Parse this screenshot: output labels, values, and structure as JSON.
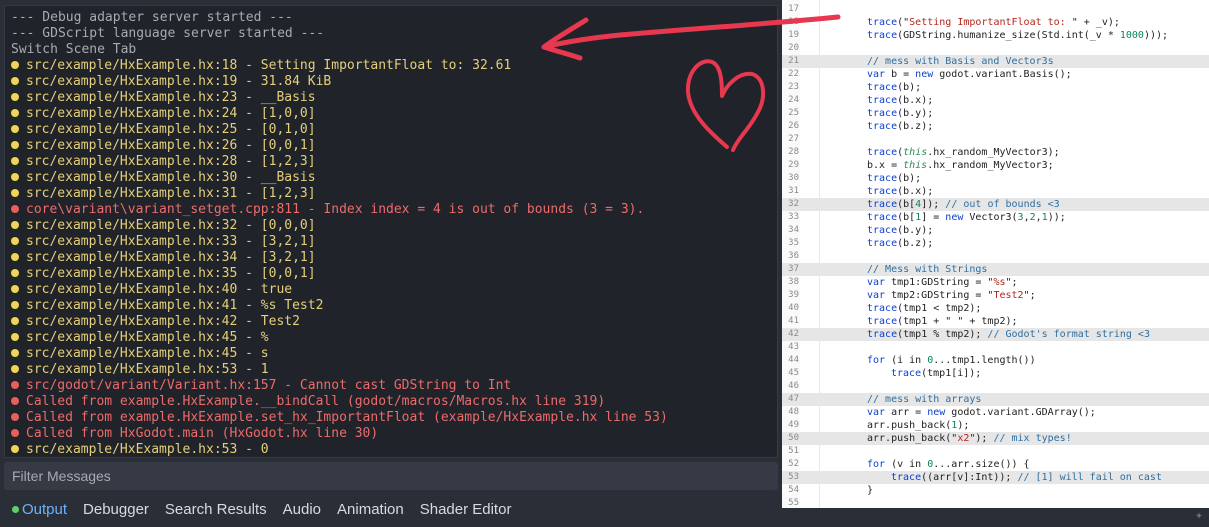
{
  "output": {
    "lines": [
      {
        "type": "plain",
        "text": "--- Debug adapter server started ---"
      },
      {
        "type": "plain",
        "text": "--- GDScript language server started ---"
      },
      {
        "type": "plain",
        "text": "Switch Scene Tab"
      },
      {
        "type": "warn",
        "text": "src/example/HxExample.hx:18 - Setting ImportantFloat to: 32.61"
      },
      {
        "type": "warn",
        "text": "src/example/HxExample.hx:19 - 31.84 KiB"
      },
      {
        "type": "warn",
        "text": "src/example/HxExample.hx:23 - __Basis"
      },
      {
        "type": "warn",
        "text": "src/example/HxExample.hx:24 - [1,0,0]"
      },
      {
        "type": "warn",
        "text": "src/example/HxExample.hx:25 - [0,1,0]"
      },
      {
        "type": "warn",
        "text": "src/example/HxExample.hx:26 - [0,0,1]"
      },
      {
        "type": "warn",
        "text": "src/example/HxExample.hx:28 - [1,2,3]"
      },
      {
        "type": "warn",
        "text": "src/example/HxExample.hx:30 - __Basis"
      },
      {
        "type": "warn",
        "text": "src/example/HxExample.hx:31 - [1,2,3]"
      },
      {
        "type": "error",
        "text": "core\\variant\\variant_setget.cpp:811 - Index index = 4 is out of bounds (3 = 3)."
      },
      {
        "type": "warn",
        "text": "src/example/HxExample.hx:32 - [0,0,0]"
      },
      {
        "type": "warn",
        "text": "src/example/HxExample.hx:33 - [3,2,1]"
      },
      {
        "type": "warn",
        "text": "src/example/HxExample.hx:34 - [3,2,1]"
      },
      {
        "type": "warn",
        "text": "src/example/HxExample.hx:35 - [0,0,1]"
      },
      {
        "type": "warn",
        "text": "src/example/HxExample.hx:40 - true"
      },
      {
        "type": "warn",
        "text": "src/example/HxExample.hx:41 - %s Test2"
      },
      {
        "type": "warn",
        "text": "src/example/HxExample.hx:42 - Test2"
      },
      {
        "type": "warn",
        "text": "src/example/HxExample.hx:45 - %"
      },
      {
        "type": "warn",
        "text": "src/example/HxExample.hx:45 - s"
      },
      {
        "type": "warn",
        "text": "src/example/HxExample.hx:53 - 1"
      },
      {
        "type": "error",
        "text": "src/godot/variant/Variant.hx:157 - Cannot cast GDString to Int"
      },
      {
        "type": "error",
        "text": "Called from example.HxExample.__bindCall (godot/macros/Macros.hx line 319)"
      },
      {
        "type": "error",
        "text": "Called from example.HxExample.set_hx_ImportantFloat (example/HxExample.hx line 53)"
      },
      {
        "type": "error",
        "text": "Called from HxGodot.main (HxGodot.hx line 30)"
      },
      {
        "type": "warn",
        "text": "src/example/HxExample.hx:53 - 0"
      }
    ]
  },
  "filter": {
    "placeholder": "Filter Messages"
  },
  "tabs": [
    {
      "label": "Output",
      "active": true
    },
    {
      "label": "Debugger",
      "active": false
    },
    {
      "label": "Search Results",
      "active": false
    },
    {
      "label": "Audio",
      "active": false
    },
    {
      "label": "Animation",
      "active": false
    },
    {
      "label": "Shader Editor",
      "active": false
    }
  ],
  "code": {
    "lines": [
      {
        "n": "17",
        "indent": 0,
        "tokens": []
      },
      {
        "n": "18",
        "indent": 0,
        "tokens": [
          [
            "kw",
            "trace"
          ],
          [
            "",
            "(\""
          ],
          [
            "str",
            "Setting ImportantFloat to: "
          ],
          [
            "",
            "\" + _v);"
          ]
        ]
      },
      {
        "n": "19",
        "indent": 0,
        "tokens": [
          [
            "kw",
            "trace"
          ],
          [
            "",
            "(GDString.humanize_size(Std.int(_v * "
          ],
          [
            "num",
            "1000"
          ],
          [
            "",
            ")));"
          ]
        ]
      },
      {
        "n": "20",
        "indent": 0,
        "tokens": []
      },
      {
        "n": "21",
        "indent": 0,
        "tokens": [
          [
            "cmt",
            "// mess with Basis and Vector3s"
          ]
        ]
      },
      {
        "n": "22",
        "indent": 0,
        "tokens": [
          [
            "kw",
            "var"
          ],
          [
            "",
            " b = "
          ],
          [
            "kw",
            "new"
          ],
          [
            "",
            " godot.variant.Basis();"
          ]
        ]
      },
      {
        "n": "23",
        "indent": 0,
        "tokens": [
          [
            "kw",
            "trace"
          ],
          [
            "",
            "(b);"
          ]
        ]
      },
      {
        "n": "24",
        "indent": 0,
        "tokens": [
          [
            "kw",
            "trace"
          ],
          [
            "",
            "(b.x);"
          ]
        ]
      },
      {
        "n": "25",
        "indent": 0,
        "tokens": [
          [
            "kw",
            "trace"
          ],
          [
            "",
            "(b.y);"
          ]
        ]
      },
      {
        "n": "26",
        "indent": 0,
        "tokens": [
          [
            "kw",
            "trace"
          ],
          [
            "",
            "(b.z);"
          ]
        ]
      },
      {
        "n": "27",
        "indent": 0,
        "tokens": []
      },
      {
        "n": "28",
        "indent": 0,
        "tokens": [
          [
            "kw",
            "trace"
          ],
          [
            "",
            "("
          ],
          [
            "this",
            "this"
          ],
          [
            "",
            ".hx_random_MyVector3);"
          ]
        ]
      },
      {
        "n": "29",
        "indent": 0,
        "tokens": [
          [
            "",
            "b.x = "
          ],
          [
            "this",
            "this"
          ],
          [
            "",
            ".hx_random_MyVector3;"
          ]
        ]
      },
      {
        "n": "30",
        "indent": 0,
        "tokens": [
          [
            "kw",
            "trace"
          ],
          [
            "",
            "(b);"
          ]
        ]
      },
      {
        "n": "31",
        "indent": 0,
        "tokens": [
          [
            "kw",
            "trace"
          ],
          [
            "",
            "(b.x);"
          ]
        ]
      },
      {
        "n": "32",
        "indent": 0,
        "tokens": [
          [
            "kw",
            "trace"
          ],
          [
            "",
            "(b["
          ],
          [
            "num",
            "4"
          ],
          [
            "",
            "]); "
          ],
          [
            "cmt",
            "// out of bounds <3"
          ]
        ]
      },
      {
        "n": "33",
        "indent": 0,
        "tokens": [
          [
            "kw",
            "trace"
          ],
          [
            "",
            "(b["
          ],
          [
            "num",
            "1"
          ],
          [
            "",
            "] = "
          ],
          [
            "kw",
            "new"
          ],
          [
            "",
            " Vector3("
          ],
          [
            "num",
            "3"
          ],
          [
            "",
            ","
          ],
          [
            "num",
            "2"
          ],
          [
            "",
            ","
          ],
          [
            "num",
            "1"
          ],
          [
            "",
            "));"
          ]
        ]
      },
      {
        "n": "34",
        "indent": 0,
        "tokens": [
          [
            "kw",
            "trace"
          ],
          [
            "",
            "(b.y);"
          ]
        ]
      },
      {
        "n": "35",
        "indent": 0,
        "tokens": [
          [
            "kw",
            "trace"
          ],
          [
            "",
            "(b.z);"
          ]
        ]
      },
      {
        "n": "36",
        "indent": 0,
        "tokens": []
      },
      {
        "n": "37",
        "indent": 0,
        "tokens": [
          [
            "cmt",
            "// Mess with Strings"
          ]
        ]
      },
      {
        "n": "38",
        "indent": 0,
        "tokens": [
          [
            "kw",
            "var"
          ],
          [
            "",
            " tmp1:GDString = \""
          ],
          [
            "str",
            "%s"
          ],
          [
            "",
            "\";"
          ]
        ]
      },
      {
        "n": "39",
        "indent": 0,
        "tokens": [
          [
            "kw",
            "var"
          ],
          [
            "",
            " tmp2:GDString = \""
          ],
          [
            "str",
            "Test2"
          ],
          [
            "",
            "\";"
          ]
        ]
      },
      {
        "n": "40",
        "indent": 0,
        "tokens": [
          [
            "kw",
            "trace"
          ],
          [
            "",
            "(tmp1 < tmp2);"
          ]
        ]
      },
      {
        "n": "41",
        "indent": 0,
        "tokens": [
          [
            "kw",
            "trace"
          ],
          [
            "",
            "(tmp1 + \" \" + tmp2);"
          ]
        ]
      },
      {
        "n": "42",
        "indent": 0,
        "tokens": [
          [
            "kw",
            "trace"
          ],
          [
            "",
            "(tmp1 % tmp2); "
          ],
          [
            "cmt",
            "// Godot's format string <3"
          ]
        ]
      },
      {
        "n": "43",
        "indent": 0,
        "tokens": []
      },
      {
        "n": "44",
        "indent": 0,
        "tokens": [
          [
            "kw",
            "for"
          ],
          [
            "",
            " (i in "
          ],
          [
            "num",
            "0"
          ],
          [
            "",
            "...tmp1.length())"
          ]
        ]
      },
      {
        "n": "45",
        "indent": 1,
        "tokens": [
          [
            "kw",
            "trace"
          ],
          [
            "",
            "(tmp1[i]);"
          ]
        ]
      },
      {
        "n": "46",
        "indent": 0,
        "tokens": []
      },
      {
        "n": "47",
        "indent": 0,
        "tokens": [
          [
            "cmt",
            "// mess with arrays"
          ]
        ]
      },
      {
        "n": "48",
        "indent": 0,
        "tokens": [
          [
            "kw",
            "var"
          ],
          [
            "",
            " arr = "
          ],
          [
            "kw",
            "new"
          ],
          [
            "",
            " godot.variant.GDArray();"
          ]
        ]
      },
      {
        "n": "49",
        "indent": 0,
        "tokens": [
          [
            "",
            "arr.push_back("
          ],
          [
            "num",
            "1"
          ],
          [
            "",
            ");"
          ]
        ]
      },
      {
        "n": "50",
        "indent": 0,
        "tokens": [
          [
            "",
            "arr.push_back(\""
          ],
          [
            "str",
            "x2"
          ],
          [
            "",
            "\"); "
          ],
          [
            "cmt",
            "// mix types!"
          ]
        ]
      },
      {
        "n": "51",
        "indent": 0,
        "tokens": []
      },
      {
        "n": "52",
        "indent": 0,
        "tokens": [
          [
            "kw",
            "for"
          ],
          [
            "",
            " (v in "
          ],
          [
            "num",
            "0"
          ],
          [
            "",
            "...arr.size()) {"
          ]
        ]
      },
      {
        "n": "53",
        "indent": 1,
        "tokens": [
          [
            "kw",
            "trace"
          ],
          [
            "",
            "((arr[v]:Int)); "
          ],
          [
            "cmt",
            "// [1] will fail on cast"
          ]
        ]
      },
      {
        "n": "54",
        "indent": 0,
        "tokens": [
          [
            "",
            "}"
          ]
        ]
      },
      {
        "n": "55",
        "indent": 0,
        "tokens": []
      }
    ],
    "highlighted": [
      "21",
      "32",
      "37",
      "42",
      "47",
      "50",
      "53"
    ]
  },
  "annotation_color": "#e8384f",
  "icons": {
    "sparkle": "sparkle-icon",
    "status_dot": "output-status-dot"
  }
}
